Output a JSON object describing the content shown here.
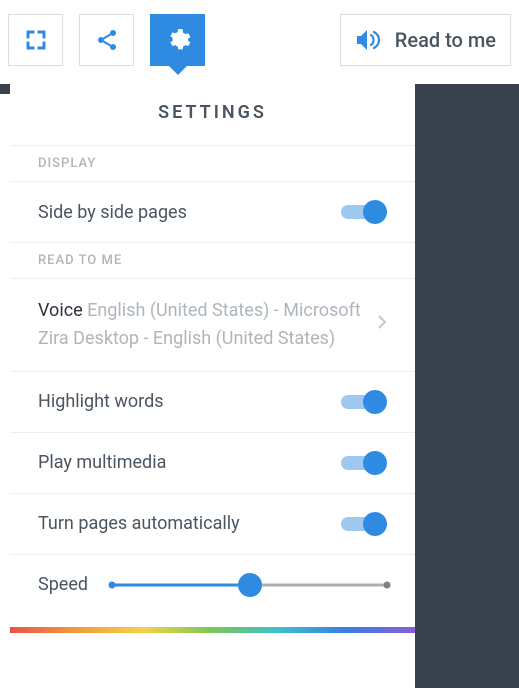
{
  "toolbar": {
    "read_label": "Read to me"
  },
  "panel": {
    "title": "SETTINGS",
    "sections": {
      "display": {
        "heading": "DISPLAY",
        "side_by_side": {
          "label": "Side by side pages",
          "on": true
        }
      },
      "read": {
        "heading": "READ TO ME",
        "voice": {
          "name": "Voice",
          "desc": "English (United States) - Microsoft Zira Desktop - English (United States)"
        },
        "highlight": {
          "label": "Highlight words",
          "on": true
        },
        "multimedia": {
          "label": "Play multimedia",
          "on": true
        },
        "autopage": {
          "label": "Turn pages automatically",
          "on": true
        },
        "speed": {
          "label": "Speed",
          "value": 0.5
        }
      }
    }
  }
}
